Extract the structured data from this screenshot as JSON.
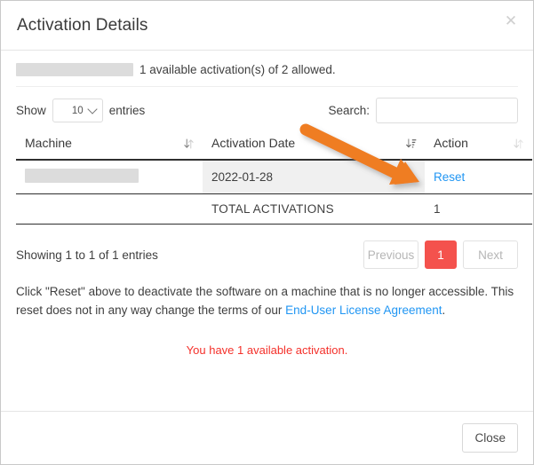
{
  "modal": {
    "title": "Activation Details",
    "close_icon": "close-icon",
    "close_button_label": "Close"
  },
  "summary": {
    "redacted_license": "",
    "text": "1 available activation(s) of 2 allowed."
  },
  "controls": {
    "show_label": "Show",
    "entries_label": "entries",
    "page_length_value": "10",
    "page_length_options": [
      "10"
    ],
    "caret_icon": "chevron-down-icon",
    "search_label": "Search:",
    "search_value": "",
    "search_placeholder": ""
  },
  "table": {
    "columns": [
      {
        "label": "Machine",
        "sort_icon": "sort-both-icon",
        "sort_state": "none"
      },
      {
        "label": "Activation Date",
        "sort_icon": "sort-descending-icon",
        "sort_state": "desc"
      },
      {
        "label": "Action",
        "sort_icon": "sort-both-icon",
        "sort_state": "none"
      }
    ],
    "rows": [
      {
        "machine": "",
        "machine_redacted": true,
        "date": "2022-01-28",
        "action": "Reset"
      }
    ],
    "totals_label": "TOTAL ACTIVATIONS",
    "totals_value": "1"
  },
  "footer": {
    "showing_info": "Showing 1 to 1 of 1 entries",
    "pagination": {
      "previous_label": "Previous",
      "next_label": "Next",
      "pages": [
        "1"
      ],
      "active_page": "1"
    }
  },
  "note": {
    "text_before": "Click \"Reset\" above to deactivate the software on a machine that is no longer accessible. This reset does not in any way change the terms of our ",
    "link_text": "End-User License Agreement",
    "text_after": "."
  },
  "warning": {
    "text": "You have 1 available activation."
  },
  "annotation": {
    "type": "arrow",
    "name": "orange-arrow-annotation",
    "points_to": "Reset"
  },
  "colors": {
    "accent_link": "#2196f3",
    "active_page": "#f4524d",
    "warning_text": "#f4302a",
    "annotation_arrow": "#ef7d22",
    "redaction": "#dcdcdc",
    "shaded_cell": "#f0f0f0"
  }
}
